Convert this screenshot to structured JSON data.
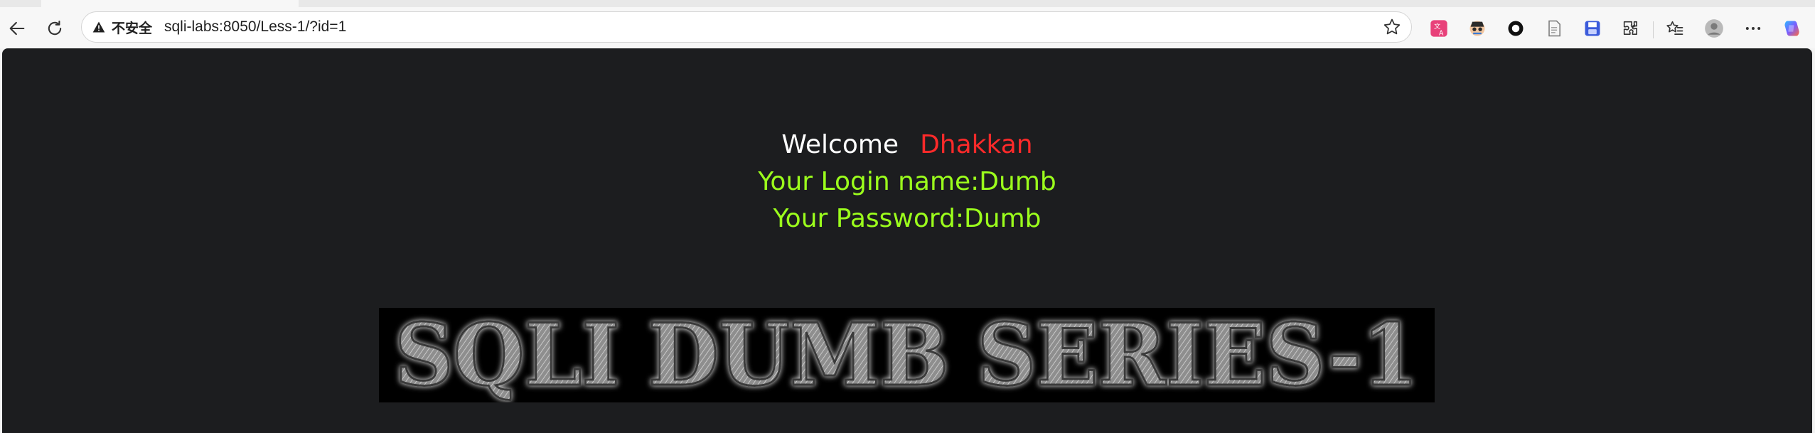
{
  "browser": {
    "security_label": "不安全",
    "url": "sqli-labs:8050/Less-1/?id=1"
  },
  "toolbar_icons": [
    "back-icon",
    "reload-icon",
    "translate-icon",
    "incognito-icon",
    "record-icon",
    "notes-icon",
    "save-icon",
    "extensions-icon",
    "favorites-icon",
    "profile-icon",
    "more-icon",
    "copilot-icon"
  ],
  "page": {
    "welcome_word": "Welcome",
    "welcome_name": "Dhakkan",
    "login_line": "Your Login name:Dumb",
    "password_line": "Your Password:Dumb",
    "banner_text": "SQLI DUMB SERIES-1"
  },
  "colors": {
    "page_bg": "#1c1d1f",
    "welcome_name": "#ff2a2a",
    "credentials": "#9cff1c"
  }
}
